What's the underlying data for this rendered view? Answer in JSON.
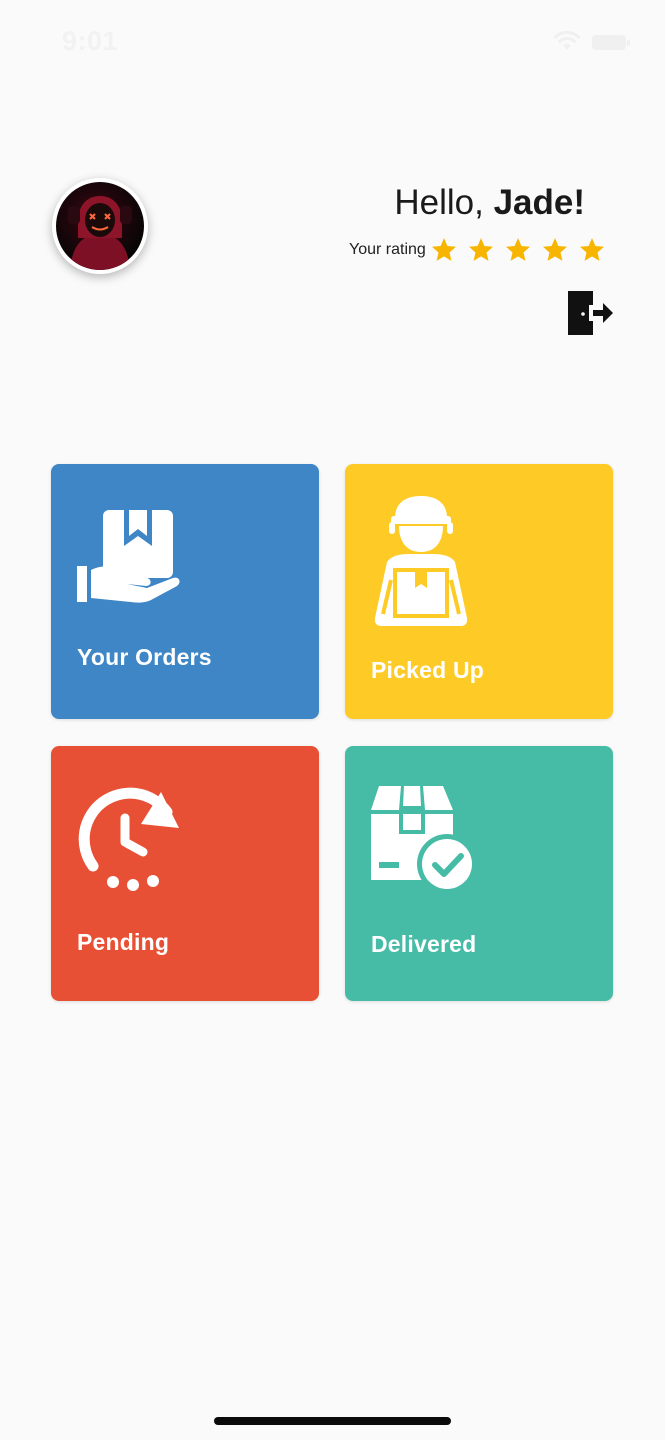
{
  "status_bar": {
    "time": "9:01"
  },
  "header": {
    "greeting_prefix": "Hello, ",
    "user_name": "Jade!",
    "rating_label": "Your rating",
    "rating_value": 5,
    "rating_max": 5
  },
  "tiles": [
    {
      "label": "Your Orders",
      "color": "#3f86c6",
      "icon": "hand-holding-box-icon"
    },
    {
      "label": "Picked Up",
      "color": "#fecb26",
      "icon": "delivery-person-icon"
    },
    {
      "label": "Pending",
      "color": "#e85035",
      "icon": "clock-refresh-icon"
    },
    {
      "label": "Delivered",
      "color": "#46bca6",
      "icon": "box-check-icon"
    }
  ],
  "colors": {
    "background": "#fafafa",
    "star": "#f7b500"
  }
}
